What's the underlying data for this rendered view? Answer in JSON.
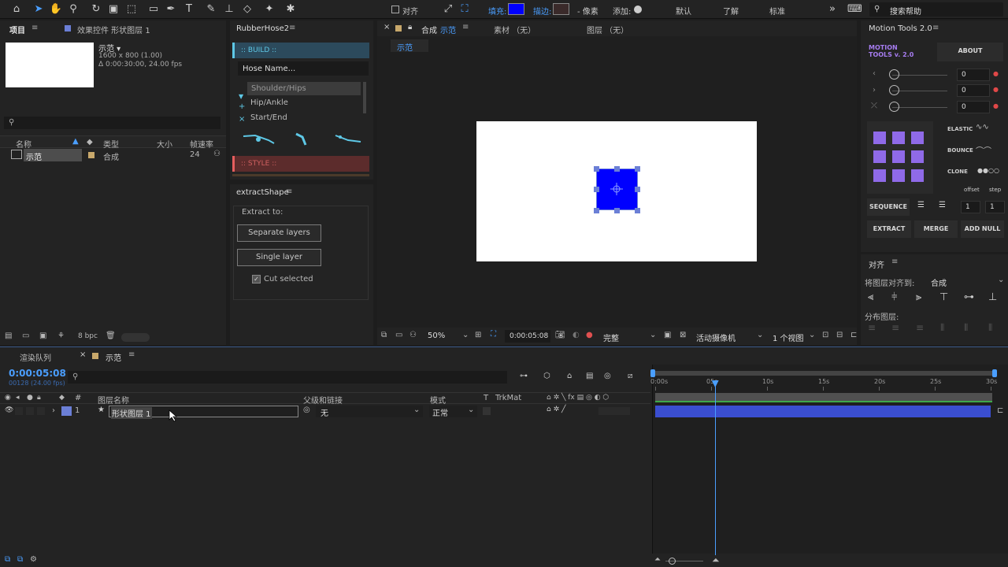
{
  "toolbar": {
    "snap_label": "对齐",
    "fill_label": "填充:",
    "stroke_label": "描边:",
    "stroke_units": "- 像素",
    "add_label": "添加:",
    "workspaces": [
      "默认",
      "了解",
      "标准"
    ],
    "search_placeholder": "搜索帮助",
    "fill_color": "#0000ff"
  },
  "project": {
    "tab": "项目",
    "effects_tab": "效果控件 形状图层 1",
    "comp_name": "示范 ▾",
    "comp_size": "1600 x 800 (1.00)",
    "comp_duration": "Δ 0:00:30:00, 24.00 fps",
    "columns": [
      "名称",
      "类型",
      "大小",
      "帧速率"
    ],
    "item_name": "示范",
    "item_type": "合成",
    "item_fps": "24",
    "bpc": "8 bpc"
  },
  "rubberhose": {
    "title": "RubberHose2",
    "build_label": ":: BUILD ::",
    "name_placeholder": "Hose Name...",
    "list": [
      "Shoulder/Hips",
      "Hip/Ankle",
      "Start/End"
    ],
    "style_label": ":: STYLE ::"
  },
  "extract": {
    "title": "extractShape",
    "group_label": "Extract to:",
    "separate_btn": "Separate layers",
    "single_btn": "Single layer",
    "cut_label": "Cut selected"
  },
  "comp": {
    "tab_label": "合成",
    "tab_name": "示范",
    "footage_tab": "素材 （无）",
    "layer_tab": "图层 （无）",
    "breadcrumb": "示范",
    "zoom": "50%",
    "timecode": "0:00:05:08",
    "quality": "完整",
    "camera": "活动摄像机",
    "views": "1 个视图",
    "shape_color": "#0000ff"
  },
  "motion_tools": {
    "title": "Motion Tools 2.0",
    "logo_line1": "MOTION",
    "logo_line2": "TOOLS v. 2.0",
    "about": "ABOUT",
    "slider_values": [
      "0",
      "0",
      "0"
    ],
    "elastic": "ELASTIC",
    "bounce": "BOUNCE",
    "clone": "CLONE",
    "offset": "offset",
    "step": "step",
    "sequence": "SEQUENCE",
    "seq_values": [
      "1",
      "1"
    ],
    "extract": "EXTRACT",
    "merge": "MERGE",
    "add_null": "ADD NULL"
  },
  "align": {
    "title": "对齐",
    "align_to_label": "将图层对齐到:",
    "align_to_value": "合成",
    "distribute_label": "分布图层:"
  },
  "timeline": {
    "render_tab": "渲染队列",
    "comp_tab": "示范",
    "timecode": "0:00:05:08",
    "frames": "00128 (24.00 fps)",
    "col_num": "#",
    "col_name": "图层名称",
    "col_parent": "父级和链接",
    "col_mode": "模式",
    "col_t": "T",
    "col_trkmat": "TrkMat",
    "layer_index": "1",
    "layer_name": "形状图层 1",
    "parent_value": "无",
    "mode_value": "正常",
    "ruler": [
      "0:00s",
      "05s",
      "10s",
      "15s",
      "20s",
      "25s",
      "30s"
    ],
    "playhead_seconds": 5.33,
    "duration_seconds": 30
  }
}
